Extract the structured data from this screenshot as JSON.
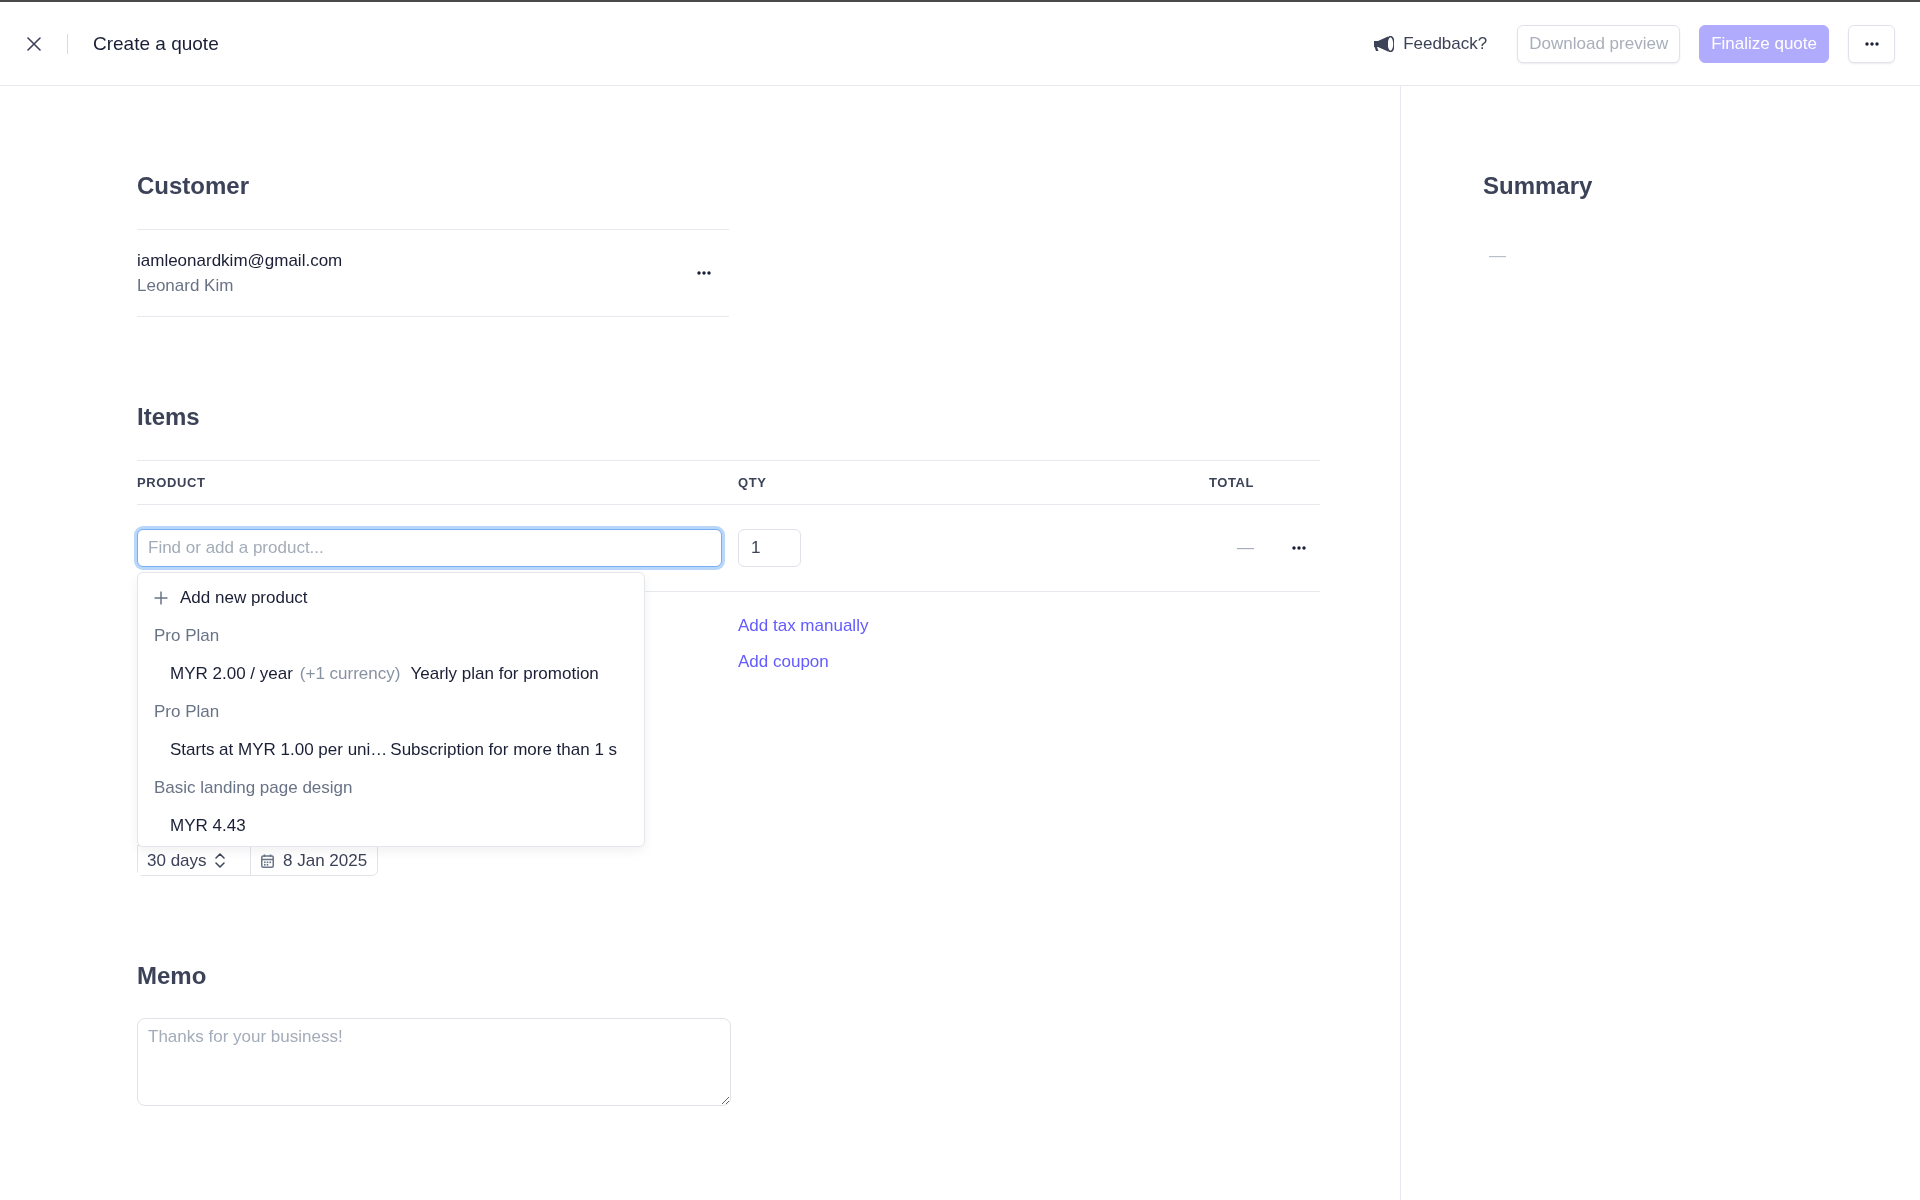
{
  "header": {
    "title": "Create a quote",
    "feedback": "Feedback?",
    "buttons": [
      {
        "label": "Download preview",
        "kind": "secondary",
        "disabled": true
      },
      {
        "label": "Finalize quote",
        "kind": "primary",
        "disabled": true
      }
    ]
  },
  "customer": {
    "heading": "Customer",
    "email": "iamleonardkim@gmail.com",
    "name": "Leonard Kim"
  },
  "items": {
    "heading": "Items",
    "columns": [
      "PRODUCT",
      "QTY",
      "TOTAL"
    ],
    "row": {
      "product_placeholder": "Find or add a product...",
      "focused": true,
      "qty": "1",
      "total": "—"
    },
    "product_menu": {
      "add_label": "Add new product",
      "groups": [
        {
          "name": "Pro Plan",
          "prices": [
            {
              "price": "MYR 2.00 / year",
              "note": "(+1 currency)",
              "description": "Yearly plan for promotion"
            }
          ]
        },
        {
          "name": "Pro Plan",
          "prices": [
            {
              "price": "Starts at MYR 1.00 per uni…",
              "description": "Subscription for more than 1 s"
            }
          ]
        },
        {
          "name": "Basic landing page design",
          "prices": [
            {
              "price": "MYR 4.43"
            }
          ]
        }
      ]
    },
    "links": [
      "Add tax manually",
      "Add coupon"
    ]
  },
  "due": {
    "days": "30 days",
    "date": "8 Jan 2025"
  },
  "memo": {
    "heading": "Memo",
    "placeholder": "Thanks for your business!"
  },
  "summary": {
    "heading": "Summary",
    "total": "—"
  }
}
